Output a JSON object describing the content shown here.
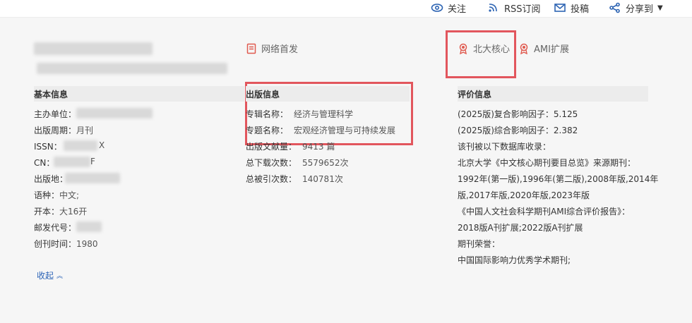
{
  "topbar": {
    "follow": "关注",
    "rss": "RSS订阅",
    "submit": "投稿",
    "share": "分享到"
  },
  "badges": {
    "network_first": "网络首发",
    "pku_core": "北大核心",
    "ami_ext": "AMI扩展"
  },
  "basic": {
    "heading": "基本信息",
    "rows": [
      {
        "label": "主办单位："
      },
      {
        "label": "出版周期：",
        "value": "月刊"
      },
      {
        "label": "ISSN：",
        "value": "X"
      },
      {
        "label": "CN：",
        "value": "F"
      },
      {
        "label": "出版地："
      },
      {
        "label": "语种：",
        "value": "中文;"
      },
      {
        "label": "开本：",
        "value": "大16开"
      },
      {
        "label": "邮发代号："
      },
      {
        "label": "创刊时间：",
        "value": "1980"
      }
    ],
    "collapse": "收起"
  },
  "publish": {
    "heading": "出版信息",
    "rows": [
      {
        "label": "专辑名称：",
        "value": "经济与管理科学"
      },
      {
        "label": "专题名称：",
        "value": "宏观经济管理与可持续发展"
      },
      {
        "label": "出版文献量：",
        "value": "9413 篇"
      },
      {
        "label": "总下载次数：",
        "value": "5579652次"
      },
      {
        "label": "总被引次数：",
        "value": "140781次"
      }
    ]
  },
  "eval": {
    "heading": "评价信息",
    "lines": [
      "(2025版)复合影响因子：5.125",
      "(2025版)综合影响因子：2.382",
      "该刊被以下数据库收录：",
      "北京大学《中文核心期刊要目总览》来源期刊：",
      "1992年(第一版),1996年(第二版),2008年版,2014年",
      "版,2017年版,2020年版,2023年版",
      "《中国人文社会科学期刊AMI综合评价报告》：",
      "2018版A刊扩展;2022版A刊扩展",
      "期刊荣誉：",
      "中国国际影响力优秀学术期刊;"
    ]
  },
  "colors": {
    "accent": "#2b63b6",
    "highlight": "#e2565d",
    "badge_red": "#e05a4f"
  }
}
